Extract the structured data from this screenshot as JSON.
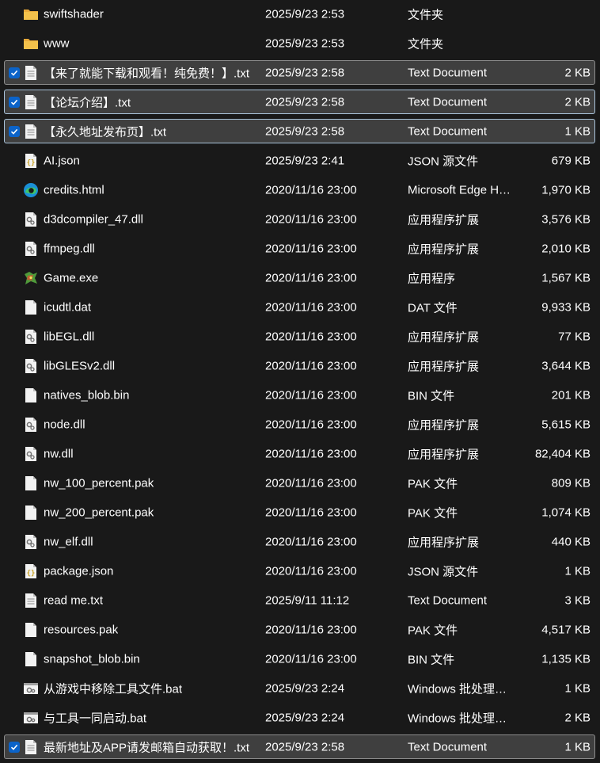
{
  "colors": {
    "background": "#191919",
    "selected_row": "#3f3f3f",
    "selection_border": "#8d8d8d",
    "checkbox": "#0b63c9",
    "folder": "#f3c14b",
    "text": "#ffffff"
  },
  "files": [
    {
      "name": "swiftshader",
      "date": "2025/9/23 2:53",
      "type": "文件夹",
      "size": "",
      "icon": "folder-icon",
      "selected": false
    },
    {
      "name": "www",
      "date": "2025/9/23 2:53",
      "type": "文件夹",
      "size": "",
      "icon": "folder-icon",
      "selected": false
    },
    {
      "name": "【来了就能下载和观看！纯免费！】.txt",
      "date": "2025/9/23 2:58",
      "type": "Text Document",
      "size": "2 KB",
      "icon": "text-file-icon",
      "selected": true
    },
    {
      "name": "【论坛介绍】.txt",
      "date": "2025/9/23 2:58",
      "type": "Text Document",
      "size": "2 KB",
      "icon": "text-file-icon",
      "selected": true,
      "focused": true
    },
    {
      "name": "【永久地址发布页】.txt",
      "date": "2025/9/23 2:58",
      "type": "Text Document",
      "size": "1 KB",
      "icon": "text-file-icon",
      "selected": true,
      "focused": true
    },
    {
      "name": "AI.json",
      "date": "2025/9/23 2:41",
      "type": "JSON 源文件",
      "size": "679 KB",
      "icon": "json-file-icon",
      "selected": false
    },
    {
      "name": "credits.html",
      "date": "2020/11/16 23:00",
      "type": "Microsoft Edge HTML Document",
      "size": "1,970 KB",
      "icon": "edge-icon",
      "selected": false
    },
    {
      "name": "d3dcompiler_47.dll",
      "date": "2020/11/16 23:00",
      "type": "应用程序扩展",
      "size": "3,576 KB",
      "icon": "dll-file-icon",
      "selected": false
    },
    {
      "name": "ffmpeg.dll",
      "date": "2020/11/16 23:00",
      "type": "应用程序扩展",
      "size": "2,010 KB",
      "icon": "dll-file-icon",
      "selected": false
    },
    {
      "name": "Game.exe",
      "date": "2020/11/16 23:00",
      "type": "应用程序",
      "size": "1,567 KB",
      "icon": "game-exe-icon",
      "selected": false
    },
    {
      "name": "icudtl.dat",
      "date": "2020/11/16 23:00",
      "type": "DAT 文件",
      "size": "9,933 KB",
      "icon": "blank-file-icon",
      "selected": false
    },
    {
      "name": "libEGL.dll",
      "date": "2020/11/16 23:00",
      "type": "应用程序扩展",
      "size": "77 KB",
      "icon": "dll-file-icon",
      "selected": false
    },
    {
      "name": "libGLESv2.dll",
      "date": "2020/11/16 23:00",
      "type": "应用程序扩展",
      "size": "3,644 KB",
      "icon": "dll-file-icon",
      "selected": false
    },
    {
      "name": "natives_blob.bin",
      "date": "2020/11/16 23:00",
      "type": "BIN 文件",
      "size": "201 KB",
      "icon": "blank-file-icon",
      "selected": false
    },
    {
      "name": "node.dll",
      "date": "2020/11/16 23:00",
      "type": "应用程序扩展",
      "size": "5,615 KB",
      "icon": "dll-file-icon",
      "selected": false
    },
    {
      "name": "nw.dll",
      "date": "2020/11/16 23:00",
      "type": "应用程序扩展",
      "size": "82,404 KB",
      "icon": "dll-file-icon",
      "selected": false
    },
    {
      "name": "nw_100_percent.pak",
      "date": "2020/11/16 23:00",
      "type": "PAK 文件",
      "size": "809 KB",
      "icon": "blank-file-icon",
      "selected": false
    },
    {
      "name": "nw_200_percent.pak",
      "date": "2020/11/16 23:00",
      "type": "PAK 文件",
      "size": "1,074 KB",
      "icon": "blank-file-icon",
      "selected": false
    },
    {
      "name": "nw_elf.dll",
      "date": "2020/11/16 23:00",
      "type": "应用程序扩展",
      "size": "440 KB",
      "icon": "dll-file-icon",
      "selected": false
    },
    {
      "name": "package.json",
      "date": "2020/11/16 23:00",
      "type": "JSON 源文件",
      "size": "1 KB",
      "icon": "json-file-icon",
      "selected": false
    },
    {
      "name": "read me.txt",
      "date": "2025/9/11 11:12",
      "type": "Text Document",
      "size": "3 KB",
      "icon": "text-file-icon",
      "selected": false
    },
    {
      "name": "resources.pak",
      "date": "2020/11/16 23:00",
      "type": "PAK 文件",
      "size": "4,517 KB",
      "icon": "blank-file-icon",
      "selected": false
    },
    {
      "name": "snapshot_blob.bin",
      "date": "2020/11/16 23:00",
      "type": "BIN 文件",
      "size": "1,135 KB",
      "icon": "blank-file-icon",
      "selected": false
    },
    {
      "name": "从游戏中移除工具文件.bat",
      "date": "2025/9/23 2:24",
      "type": "Windows 批处理文件",
      "size": "1 KB",
      "icon": "batch-file-icon",
      "selected": false
    },
    {
      "name": "与工具一同启动.bat",
      "date": "2025/9/23 2:24",
      "type": "Windows 批处理文件",
      "size": "2 KB",
      "icon": "batch-file-icon",
      "selected": false
    },
    {
      "name": "最新地址及APP请发邮箱自动获取！.txt",
      "date": "2025/9/23 2:58",
      "type": "Text Document",
      "size": "1 KB",
      "icon": "text-file-icon",
      "selected": true
    }
  ]
}
